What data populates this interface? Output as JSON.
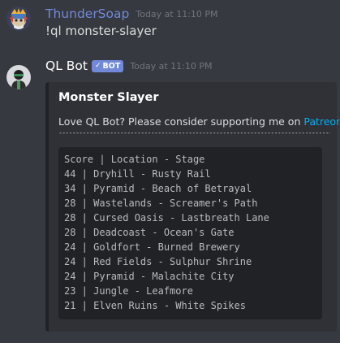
{
  "messages": [
    {
      "author": "ThunderSoap",
      "timestamp": "Today at 11:10 PM",
      "text": "!ql monster-slayer"
    },
    {
      "author": "QL Bot",
      "bot_badge": "BOT",
      "timestamp": "Today at 11:10 PM"
    }
  ],
  "embed": {
    "title": "Monster Slayer",
    "description_prefix": "Love QL Bot? Please consider supporting me on ",
    "description_link": "Patreon",
    "divider": "--------------------------------------------------------------------------------------",
    "code_lines": [
      "Score | Location - Stage",
      "44 | Dryhill - Rusty Rail",
      "34 | Pyramid - Beach of Betrayal",
      "28 | Wastelands - Screamer's Path",
      "28 | Cursed Oasis - Lastbreath Lane",
      "28 | Deadcoast - Ocean's Gate",
      "24 | Goldfort - Burned Brewery",
      "24 | Red Fields - Sulphur Shrine",
      "24 | Pyramid - Malachite City",
      "23 | Jungle - Leafmore",
      "21 | Elven Ruins - White Spikes"
    ]
  },
  "colors": {
    "background": "#36393f",
    "embed_bg": "#2f3136",
    "code_bg": "#202225",
    "username_thunder": "#7289da",
    "link": "#00b0f4",
    "bot_badge": "#7289da"
  },
  "icons": {
    "thunder_avatar": "helmet-avatar-icon",
    "bot_avatar": "bot-avatar-icon",
    "verified_check": "check-icon"
  }
}
